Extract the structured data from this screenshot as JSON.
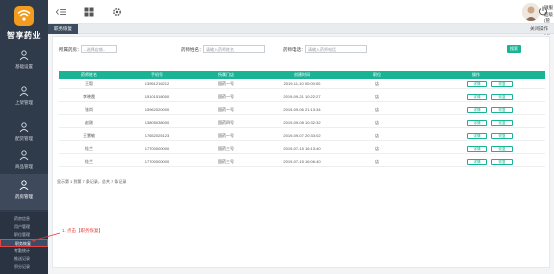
{
  "app": {
    "logo_text": "智享药业",
    "brand_color": "#f29c1f",
    "accent": "#1ab394"
  },
  "sidebar": {
    "items": [
      {
        "label": "基础设置",
        "icon": "person-icon"
      },
      {
        "label": "上架管理",
        "icon": "person-icon"
      },
      {
        "label": "配货管理",
        "icon": "person-icon"
      },
      {
        "label": "商品管理",
        "icon": "person-icon"
      },
      {
        "label": "药房管理",
        "icon": "person-icon"
      }
    ],
    "submenu": [
      "药房信息",
      "用户管理",
      "职位管理",
      "职务恢复",
      "考勤统计",
      "推送记录",
      "积分记录"
    ]
  },
  "topbar": {
    "user_name": "微服",
    "user_role": "超级(管理员)"
  },
  "tabs": {
    "active": "职务恢复",
    "ops": "关闭操作"
  },
  "filters": {
    "company_label": "所属药房：",
    "company_placeholder": "--选择店铺--",
    "name_label": "药师姓名：",
    "name_placeholder": "请输入药师姓名",
    "phone_label": "药师电话：",
    "phone_placeholder": "请输入药师电话",
    "search_label": "搜索"
  },
  "table": {
    "headers": [
      "药师姓名",
      "手机号",
      "所属门店",
      "创建时间",
      "职位",
      "操作"
    ],
    "rows": [
      {
        "name": "王毅",
        "phone": "13951216212",
        "store": "国药一号",
        "time": "2019-11-10 00:00:00",
        "role": "店"
      },
      {
        "name": "李晓霞",
        "phone": "15101518000",
        "store": "国药一号",
        "time": "2019-09-21 10:22:27",
        "role": "店"
      },
      {
        "name": "张尚",
        "phone": "15962020000",
        "store": "国药一号",
        "time": "2019-09-06 21:13:34",
        "role": "店"
      },
      {
        "name": "赵刚",
        "phone": "13805038000",
        "store": "国药四号",
        "time": "2019-09-08 10:32:32",
        "role": "店"
      },
      {
        "name": "王慧敏",
        "phone": "17652025123",
        "store": "国药一号",
        "time": "2019-09-07 20:33:02",
        "role": "店"
      },
      {
        "name": "桂兰",
        "phone": "17700000000",
        "store": "国药三号",
        "time": "2019-07-15 16:13:40",
        "role": "店"
      },
      {
        "name": "桂兰",
        "phone": "17700000000",
        "store": "国药三号",
        "time": "2019-07-15 16:06:40",
        "role": "店"
      }
    ],
    "op_edit": "详情",
    "op_restore": "恢复"
  },
  "pager": {
    "text": "显示第 1 到第 7 条记录，总共 7 条记录"
  },
  "annotation": {
    "text": "1. 点击【职务恢复】"
  }
}
